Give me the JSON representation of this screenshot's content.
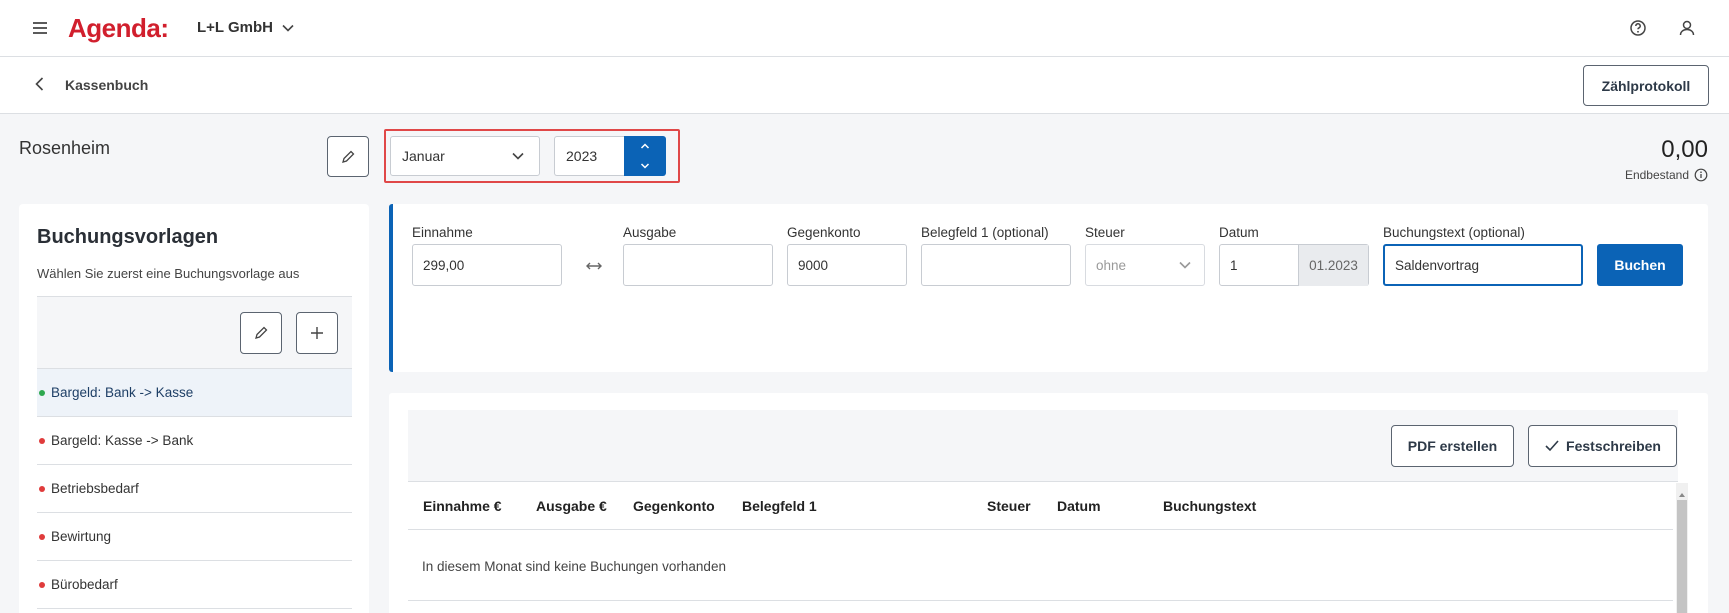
{
  "header": {
    "logo": "Agenda:",
    "company": "L+L GmbH",
    "colors": {
      "brand": "#d11f2d",
      "accent": "#0b63b6"
    },
    "icons": [
      "menu-icon",
      "help-icon",
      "user-icon",
      "chevron-down-icon"
    ]
  },
  "subheader": {
    "back_label": "Kassenbuch",
    "zaehlprotokoll_label": "Zählprotokoll"
  },
  "location": {
    "name": "Rosenheim",
    "month": "Januar",
    "year": "2023",
    "balance": "0,00",
    "balance_label": "Endbestand"
  },
  "templates": {
    "title": "Buchungsvorlagen",
    "subtitle": "Wählen Sie zuerst eine Buchungsvorlage aus",
    "items": [
      {
        "label": "Bargeld: Bank -> Kasse",
        "status": "green",
        "active": true
      },
      {
        "label": "Bargeld: Kasse -> Bank",
        "status": "red",
        "active": false
      },
      {
        "label": "Betriebsbedarf",
        "status": "red",
        "active": false
      },
      {
        "label": "Bewirtung",
        "status": "red",
        "active": false
      },
      {
        "label": "Bürobedarf",
        "status": "red",
        "active": false
      }
    ],
    "status_colors": {
      "green": "#2ea84f",
      "red": "#e03b3b"
    }
  },
  "form": {
    "einnahme": {
      "label": "Einnahme",
      "value": "299,00"
    },
    "ausgabe": {
      "label": "Ausgabe",
      "value": ""
    },
    "gegenkonto": {
      "label": "Gegenkonto",
      "value": "9000"
    },
    "belegfeld": {
      "label": "Belegfeld 1 (optional)",
      "value": ""
    },
    "steuer": {
      "label": "Steuer",
      "value": "ohne"
    },
    "datum": {
      "label": "Datum",
      "value": "1",
      "suffix": "01.2023"
    },
    "buchungstext": {
      "label": "Buchungstext (optional)",
      "value": "Saldenvortrag"
    },
    "submit_label": "Buchen"
  },
  "table": {
    "pdf_label": "PDF erstellen",
    "festschreiben_label": "Festschreiben",
    "columns": [
      "Einnahme €",
      "Ausgabe €",
      "Gegenkonto",
      "Belegfeld 1",
      "Steuer",
      "Datum",
      "Buchungstext"
    ],
    "empty_message": "In diesem Monat sind keine Buchungen vorhanden"
  }
}
